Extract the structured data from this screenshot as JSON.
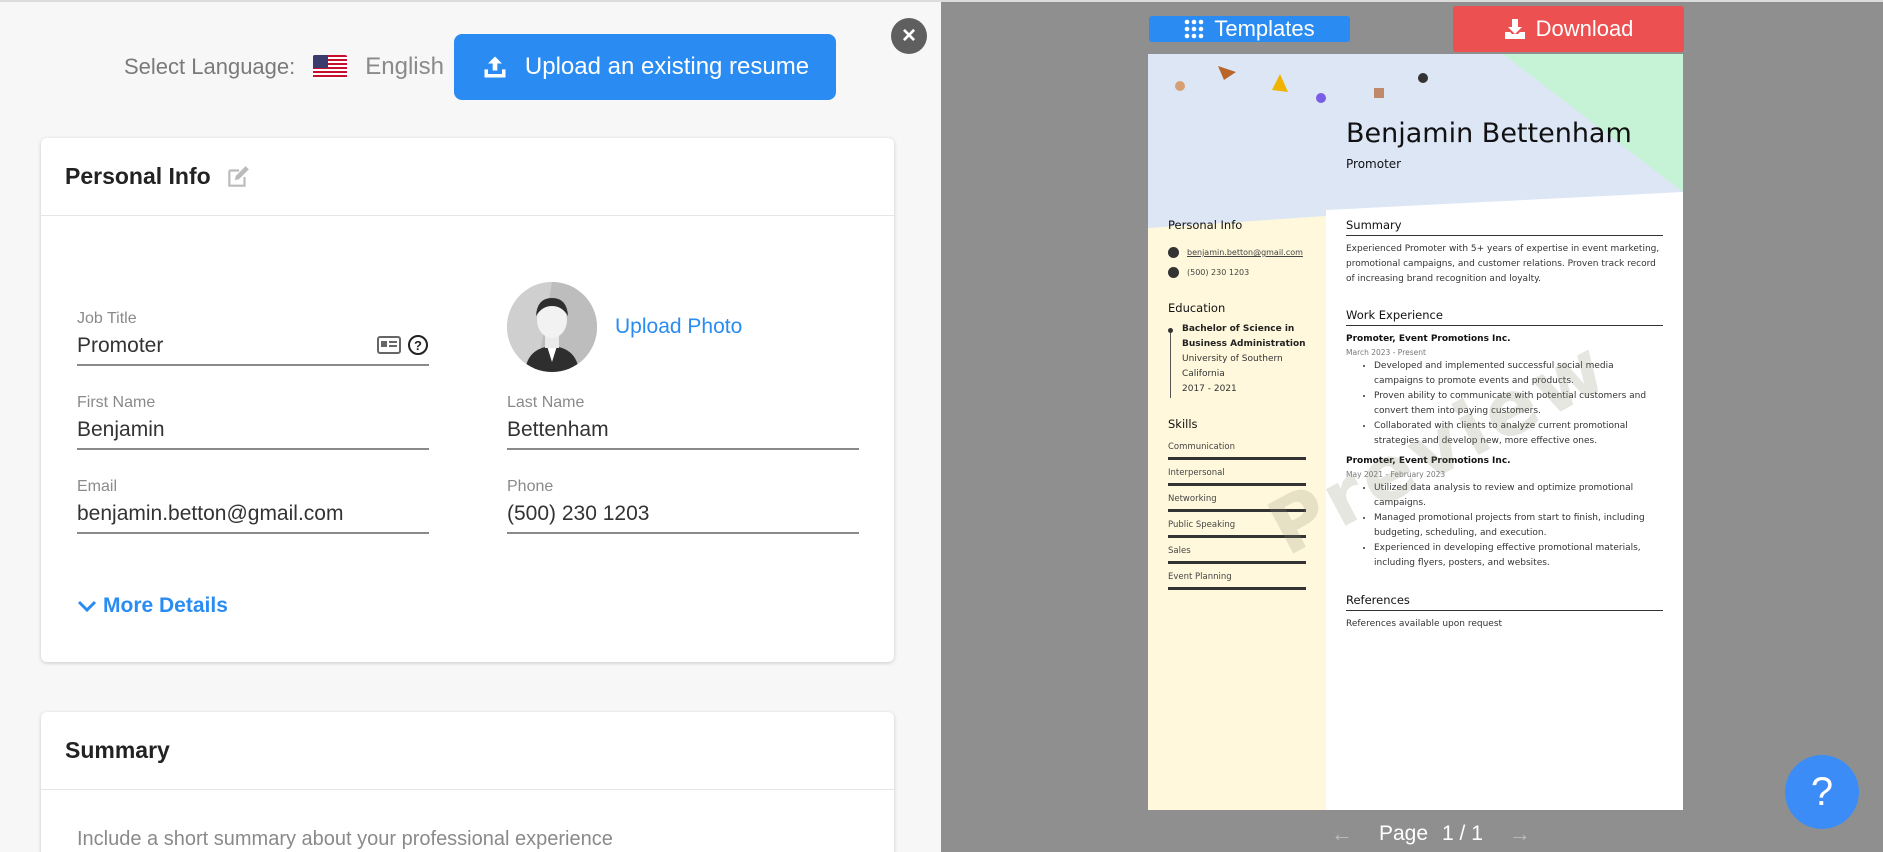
{
  "editor": {
    "close_label": "×",
    "language": {
      "label": "Select Language:",
      "value": "English",
      "flag_icon": "us-flag-icon"
    },
    "upload_resume_label": "Upload an existing resume",
    "personal_info": {
      "title": "Personal Info",
      "job_title": {
        "label": "Job Title",
        "value": "Promoter"
      },
      "first_name": {
        "label": "First Name",
        "value": "Benjamin"
      },
      "last_name": {
        "label": "Last Name",
        "value": "Bettenham"
      },
      "email": {
        "label": "Email",
        "value": "benjamin.betton@gmail.com"
      },
      "phone": {
        "label": "Phone",
        "value": "(500) 230 1203"
      },
      "upload_photo_label": "Upload Photo",
      "more_details_label": "More Details"
    },
    "summary": {
      "title": "Summary",
      "placeholder": "Include a short summary about your professional experience"
    }
  },
  "preview": {
    "templates_label": "Templates",
    "download_label": "Download",
    "pager": {
      "label": "Page",
      "value": "1 / 1"
    },
    "help_label": "?",
    "watermark": "Preview",
    "resume": {
      "name": "Benjamin Bettenham",
      "title": "Promoter",
      "personal_info_heading": "Personal Info",
      "email": "benjamin.betton@gmail.com",
      "phone": "(500) 230 1203",
      "education_heading": "Education",
      "education": {
        "degree_line1": "Bachelor of Science in",
        "degree_line2": "Business Administration",
        "school_line1": "University of Southern",
        "school_line2": "California",
        "years": "2017 - 2021"
      },
      "skills_heading": "Skills",
      "skills": [
        "Communication",
        "Interpersonal",
        "Networking",
        "Public Speaking",
        "Sales",
        "Event Planning"
      ],
      "summary_heading": "Summary",
      "summary_lines": [
        "Experienced Promoter with 5+ years of expertise in event marketing,",
        "promotional campaigns, and customer relations. Proven track record",
        "of increasing brand recognition and loyalty."
      ],
      "work_heading": "Work Experience",
      "jobs": [
        {
          "role": "Promoter, Event Promotions Inc.",
          "dates": "March 2023 - Present",
          "bullets": [
            "Developed and implemented successful social media campaigns to promote events and products.",
            "Proven ability to communicate with potential customers and convert them into paying customers.",
            "Collaborated with clients to analyze current promotional strategies and develop new, more effective ones."
          ]
        },
        {
          "role": "Promoter, Event Promotions Inc.",
          "dates": "May 2021 - February 2023",
          "bullets": [
            "Utilized data analysis to review and optimize promotional campaigns.",
            "Managed promotional projects from start to finish, including budgeting, scheduling, and execution.",
            "Experienced in developing effective promotional materials, including flyers, posters, and websites."
          ]
        }
      ],
      "references_heading": "References",
      "references_text": "References available upon request"
    }
  },
  "colors": {
    "accent": "#2a8cf2",
    "download": "#ec5050",
    "help": "#3c8cf7",
    "preview_bg": "#8f8f8f",
    "resume_sidebar": "#fff8dc"
  }
}
